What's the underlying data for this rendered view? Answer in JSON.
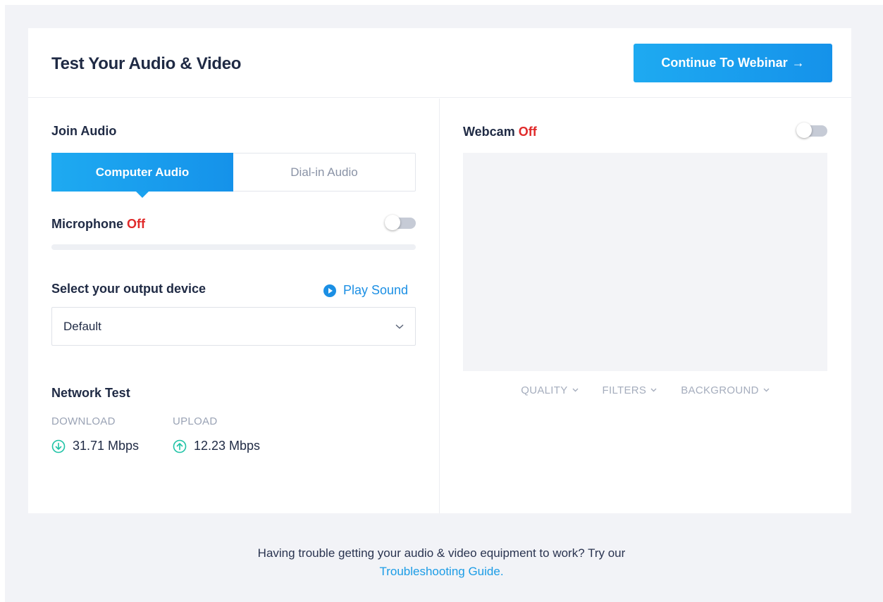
{
  "header": {
    "title": "Test Your Audio & Video",
    "continue_label": "Continue To Webinar",
    "continue_arrow": "→"
  },
  "audio": {
    "join_label": "Join Audio",
    "tabs": [
      {
        "label": "Computer Audio",
        "active": true
      },
      {
        "label": "Dial-in Audio",
        "active": false
      }
    ],
    "microphone": {
      "label": "Microphone",
      "state": "Off",
      "enabled": false,
      "level_percent": 0
    },
    "output": {
      "label": "Select your output device",
      "play_sound_label": "Play Sound",
      "selected": "Default"
    }
  },
  "network": {
    "label": "Network Test",
    "download_label": "DOWNLOAD",
    "upload_label": "UPLOAD",
    "download_value": "31.71 Mbps",
    "upload_value": "12.23 Mbps"
  },
  "webcam": {
    "label": "Webcam",
    "state": "Off",
    "enabled": false,
    "options": [
      "QUALITY",
      "FILTERS",
      "BACKGROUND"
    ]
  },
  "footer": {
    "text": "Having trouble getting your audio & video equipment to work? Try our",
    "link": "Troubleshooting Guide."
  },
  "colors": {
    "accent": "#1592ea",
    "off": "#e02a2a",
    "network_icon": "#1fc3a6",
    "background": "#f2f3f7"
  }
}
